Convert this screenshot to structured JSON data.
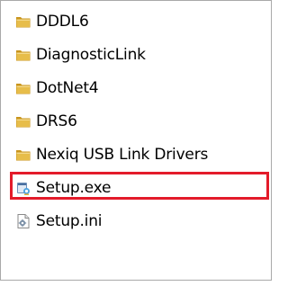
{
  "window": {
    "frame_border": "#a9a9a9"
  },
  "files": [
    {
      "name": "DDDL6",
      "icon": "folder-icon",
      "type": "folder"
    },
    {
      "name": "DiagnosticLink",
      "icon": "folder-icon",
      "type": "folder"
    },
    {
      "name": "DotNet4",
      "icon": "folder-icon",
      "type": "folder"
    },
    {
      "name": "DRS6",
      "icon": "folder-icon",
      "type": "folder"
    },
    {
      "name": "Nexiq USB Link Drivers",
      "icon": "folder-icon",
      "type": "folder"
    },
    {
      "name": "Setup.exe",
      "icon": "setup-exe-icon",
      "type": "application",
      "highlighted": true
    },
    {
      "name": "Setup.ini",
      "icon": "settings-file-icon",
      "type": "config"
    }
  ],
  "colors": {
    "folder": "#e7bd4a",
    "folder_dark": "#c9951d",
    "highlight": "#e31b2a"
  }
}
